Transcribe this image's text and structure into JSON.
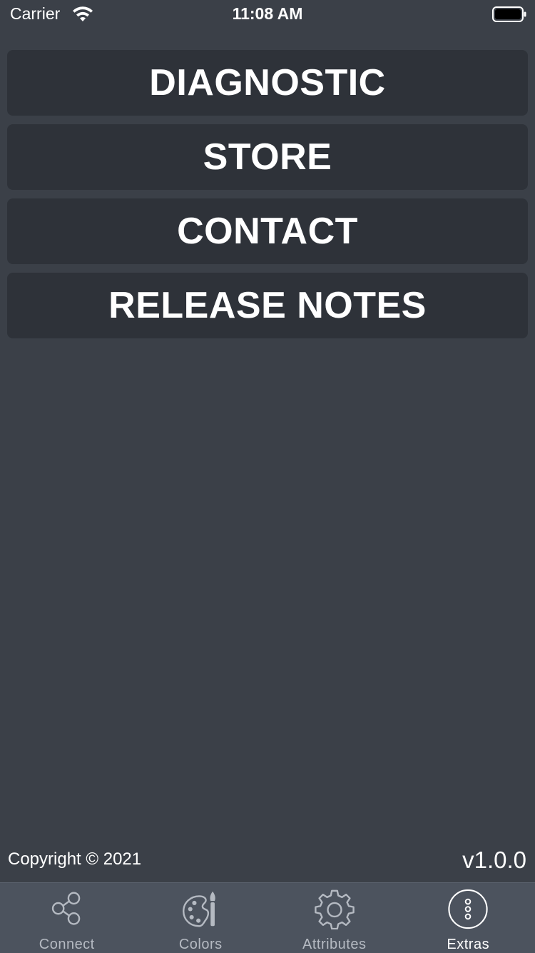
{
  "status_bar": {
    "carrier": "Carrier",
    "time": "11:08 AM"
  },
  "menu": {
    "items": [
      {
        "label": "DIAGNOSTIC"
      },
      {
        "label": "STORE"
      },
      {
        "label": "CONTACT"
      },
      {
        "label": "RELEASE NOTES"
      }
    ]
  },
  "footer": {
    "copyright": "Copyright © 2021",
    "version": "v1.0.0"
  },
  "tab_bar": {
    "tabs": [
      {
        "label": "Connect",
        "icon": "share-nodes-icon"
      },
      {
        "label": "Colors",
        "icon": "palette-icon"
      },
      {
        "label": "Attributes",
        "icon": "gear-icon"
      },
      {
        "label": "Extras",
        "icon": "more-dots-icon",
        "active": true
      }
    ]
  },
  "colors": {
    "background": "#3b4048",
    "button": "#2e3239",
    "tab_bar": "#4c535e",
    "tab_inactive": "#b5bac2",
    "tab_active": "#ffffff"
  }
}
